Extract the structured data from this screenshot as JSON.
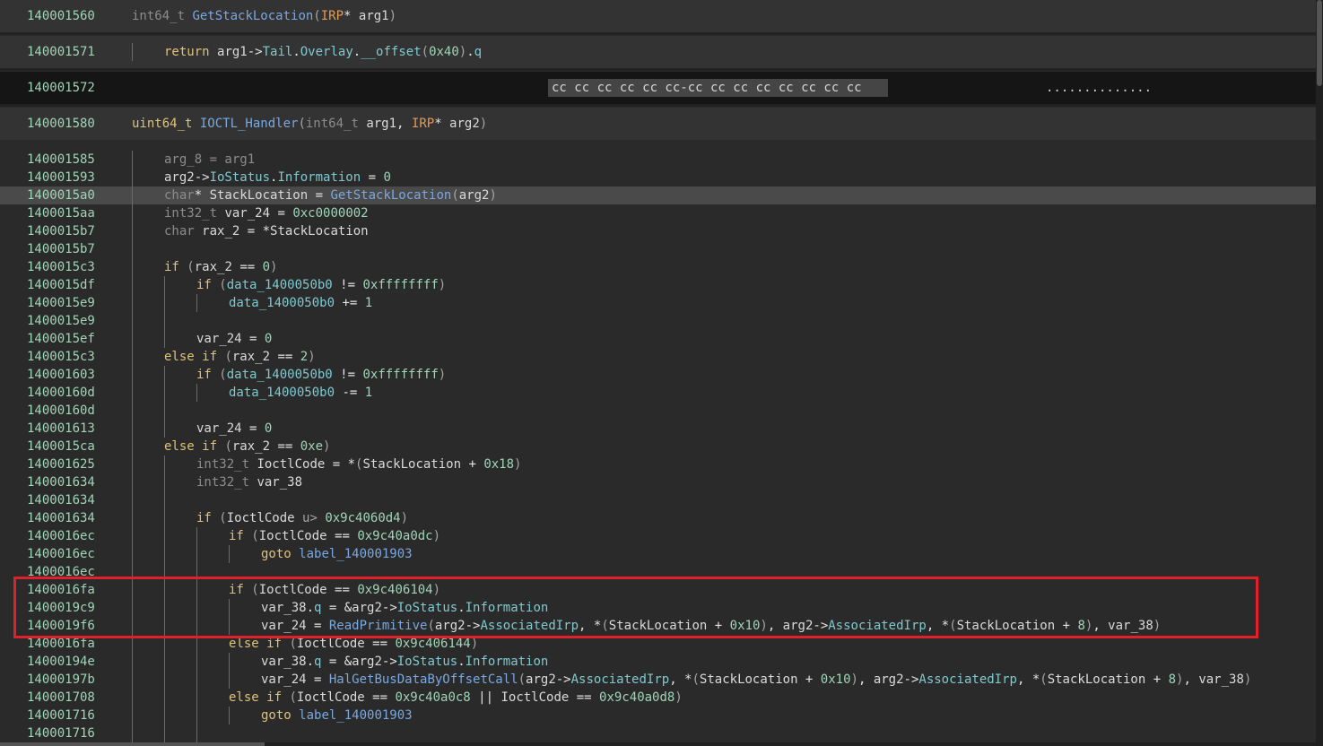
{
  "headers": [
    {
      "addr": "140001560",
      "dark": false,
      "tokens": [
        [
          "int64_t ",
          "ty"
        ],
        [
          "GetStackLocation",
          "fn"
        ],
        [
          "(",
          "gr"
        ],
        [
          "IRP",
          "irp"
        ],
        [
          "* ",
          "pl"
        ],
        [
          "arg1",
          "var"
        ],
        [
          ")",
          "gr"
        ]
      ]
    },
    {
      "addr": "140001571",
      "dark": false,
      "tokens": [
        [
          "return ",
          "kw"
        ],
        [
          "arg1",
          "var"
        ],
        [
          "->",
          "pl"
        ],
        [
          "Tail",
          "mem"
        ],
        [
          ".",
          "pl"
        ],
        [
          "Overlay",
          "mem"
        ],
        [
          ".",
          "pl"
        ],
        [
          "__offset",
          "mem"
        ],
        [
          "(",
          "gr"
        ],
        [
          "0x40",
          "num"
        ],
        [
          ")",
          "gr"
        ],
        [
          ".",
          "pl"
        ],
        [
          "q",
          "mem"
        ]
      ]
    },
    {
      "addr": "140001572",
      "dark": true,
      "hex": "cc cc cc cc cc cc-cc cc cc cc cc cc cc cc",
      "ascii": ".............."
    },
    {
      "addr": "140001580",
      "dark": false,
      "tokens": [
        [
          "uint64_t ",
          "kw"
        ],
        [
          "IOCTL_Handler",
          "fn"
        ],
        [
          "(",
          "gr"
        ],
        [
          "int64_t ",
          "ty"
        ],
        [
          "arg1",
          "var"
        ],
        [
          ", ",
          "pl"
        ],
        [
          "IRP",
          "irp"
        ],
        [
          "* ",
          "pl"
        ],
        [
          "arg2",
          "var"
        ],
        [
          ")",
          "gr"
        ]
      ]
    }
  ],
  "lines": [
    {
      "addr": "140001585",
      "indent": 1,
      "hl": false,
      "tokens": [
        [
          "arg_8 = arg1",
          "ty"
        ]
      ]
    },
    {
      "addr": "140001593",
      "indent": 1,
      "hl": false,
      "tokens": [
        [
          "arg2",
          "var"
        ],
        [
          "->",
          "pl"
        ],
        [
          "IoStatus",
          "mem"
        ],
        [
          ".",
          "pl"
        ],
        [
          "Information",
          "mem"
        ],
        [
          " = ",
          "pl"
        ],
        [
          "0",
          "num"
        ]
      ]
    },
    {
      "addr": "1400015a0",
      "indent": 1,
      "hl": true,
      "tokens": [
        [
          "char",
          "ty"
        ],
        [
          "* ",
          "pl"
        ],
        [
          "StackLocation",
          "var"
        ],
        [
          " = ",
          "pl"
        ],
        [
          "GetStackLocation",
          "fn"
        ],
        [
          "(",
          "gr"
        ],
        [
          "arg2",
          "var"
        ],
        [
          ")",
          "gr"
        ]
      ]
    },
    {
      "addr": "1400015aa",
      "indent": 1,
      "hl": false,
      "tokens": [
        [
          "int32_t ",
          "ty"
        ],
        [
          "var_24",
          "var"
        ],
        [
          " = ",
          "pl"
        ],
        [
          "0xc0000002",
          "num"
        ]
      ]
    },
    {
      "addr": "1400015b7",
      "indent": 1,
      "hl": false,
      "tokens": [
        [
          "char ",
          "ty"
        ],
        [
          "rax_2",
          "var"
        ],
        [
          " = *",
          "pl"
        ],
        [
          "StackLocation",
          "var"
        ]
      ]
    },
    {
      "addr": "1400015b7",
      "indent": 1,
      "hl": false,
      "tokens": []
    },
    {
      "addr": "1400015c3",
      "indent": 1,
      "hl": false,
      "tokens": [
        [
          "if ",
          "kw"
        ],
        [
          "(",
          "gr"
        ],
        [
          "rax_2",
          "var"
        ],
        [
          " == ",
          "pl"
        ],
        [
          "0",
          "num"
        ],
        [
          ")",
          "gr"
        ]
      ]
    },
    {
      "addr": "1400015df",
      "indent": 2,
      "hl": false,
      "tokens": [
        [
          "if ",
          "kw"
        ],
        [
          "(",
          "gr"
        ],
        [
          "data_1400050b0",
          "mem"
        ],
        [
          " != ",
          "pl"
        ],
        [
          "0xffffffff",
          "num"
        ],
        [
          ")",
          "gr"
        ]
      ]
    },
    {
      "addr": "1400015e9",
      "indent": 3,
      "hl": false,
      "tokens": [
        [
          "data_1400050b0",
          "mem"
        ],
        [
          " += ",
          "pl"
        ],
        [
          "1",
          "num"
        ]
      ]
    },
    {
      "addr": "1400015e9",
      "indent": 2,
      "hl": false,
      "tokens": []
    },
    {
      "addr": "1400015ef",
      "indent": 2,
      "hl": false,
      "tokens": [
        [
          "var_24",
          "var"
        ],
        [
          " = ",
          "pl"
        ],
        [
          "0",
          "num"
        ]
      ]
    },
    {
      "addr": "1400015c3",
      "indent": 1,
      "hl": false,
      "tokens": [
        [
          "else if ",
          "kw"
        ],
        [
          "(",
          "gr"
        ],
        [
          "rax_2",
          "var"
        ],
        [
          " == ",
          "pl"
        ],
        [
          "2",
          "num"
        ],
        [
          ")",
          "gr"
        ]
      ]
    },
    {
      "addr": "140001603",
      "indent": 2,
      "hl": false,
      "tokens": [
        [
          "if ",
          "kw"
        ],
        [
          "(",
          "gr"
        ],
        [
          "data_1400050b0",
          "mem"
        ],
        [
          " != ",
          "pl"
        ],
        [
          "0xffffffff",
          "num"
        ],
        [
          ")",
          "gr"
        ]
      ]
    },
    {
      "addr": "14000160d",
      "indent": 3,
      "hl": false,
      "tokens": [
        [
          "data_1400050b0",
          "mem"
        ],
        [
          " -= ",
          "pl"
        ],
        [
          "1",
          "num"
        ]
      ]
    },
    {
      "addr": "14000160d",
      "indent": 2,
      "hl": false,
      "tokens": []
    },
    {
      "addr": "140001613",
      "indent": 2,
      "hl": false,
      "tokens": [
        [
          "var_24",
          "var"
        ],
        [
          " = ",
          "pl"
        ],
        [
          "0",
          "num"
        ]
      ]
    },
    {
      "addr": "1400015ca",
      "indent": 1,
      "hl": false,
      "tokens": [
        [
          "else if ",
          "kw"
        ],
        [
          "(",
          "gr"
        ],
        [
          "rax_2",
          "var"
        ],
        [
          " == ",
          "pl"
        ],
        [
          "0xe",
          "num"
        ],
        [
          ")",
          "gr"
        ]
      ]
    },
    {
      "addr": "140001625",
      "indent": 2,
      "hl": false,
      "tokens": [
        [
          "int32_t ",
          "ty"
        ],
        [
          "IoctlCode",
          "var"
        ],
        [
          " = *",
          "pl"
        ],
        [
          "(",
          "gr"
        ],
        [
          "StackLocation",
          "var"
        ],
        [
          " + ",
          "pl"
        ],
        [
          "0x18",
          "num"
        ],
        [
          ")",
          "gr"
        ]
      ]
    },
    {
      "addr": "140001634",
      "indent": 2,
      "hl": false,
      "tokens": [
        [
          "int32_t ",
          "ty"
        ],
        [
          "var_38",
          "var"
        ]
      ]
    },
    {
      "addr": "140001634",
      "indent": 2,
      "hl": false,
      "tokens": []
    },
    {
      "addr": "140001634",
      "indent": 2,
      "hl": false,
      "tokens": [
        [
          "if ",
          "kw"
        ],
        [
          "(",
          "gr"
        ],
        [
          "IoctlCode",
          "var"
        ],
        [
          " u> ",
          "gr"
        ],
        [
          "0x9c4060d4",
          "num"
        ],
        [
          ")",
          "gr"
        ]
      ]
    },
    {
      "addr": "1400016ec",
      "indent": 3,
      "hl": false,
      "tokens": [
        [
          "if ",
          "kw"
        ],
        [
          "(",
          "gr"
        ],
        [
          "IoctlCode",
          "var"
        ],
        [
          " == ",
          "pl"
        ],
        [
          "0x9c40a0dc",
          "num"
        ],
        [
          ")",
          "gr"
        ]
      ]
    },
    {
      "addr": "1400016ec",
      "indent": 4,
      "hl": false,
      "tokens": [
        [
          "goto ",
          "kw"
        ],
        [
          "label_140001903",
          "lbl"
        ]
      ]
    },
    {
      "addr": "1400016ec",
      "indent": 3,
      "hl": false,
      "tokens": []
    },
    {
      "addr": "1400016fa",
      "indent": 3,
      "hl": false,
      "tokens": [
        [
          "if ",
          "kw"
        ],
        [
          "(",
          "gr"
        ],
        [
          "IoctlCode",
          "var"
        ],
        [
          " == ",
          "pl"
        ],
        [
          "0x9c406104",
          "num"
        ],
        [
          ")",
          "gr"
        ]
      ]
    },
    {
      "addr": "1400019c9",
      "indent": 4,
      "hl": false,
      "tokens": [
        [
          "var_38",
          "var"
        ],
        [
          ".",
          "pl"
        ],
        [
          "q",
          "mem"
        ],
        [
          " = &",
          "pl"
        ],
        [
          "arg2",
          "var"
        ],
        [
          "->",
          "pl"
        ],
        [
          "IoStatus",
          "mem"
        ],
        [
          ".",
          "pl"
        ],
        [
          "Information",
          "mem"
        ]
      ]
    },
    {
      "addr": "1400019f6",
      "indent": 4,
      "hl": false,
      "tokens": [
        [
          "var_24",
          "var"
        ],
        [
          " = ",
          "pl"
        ],
        [
          "ReadPrimitive",
          "fn"
        ],
        [
          "(",
          "gr"
        ],
        [
          "arg2",
          "var"
        ],
        [
          "->",
          "pl"
        ],
        [
          "AssociatedIrp",
          "mem"
        ],
        [
          ", *",
          "pl"
        ],
        [
          "(",
          "gr"
        ],
        [
          "StackLocation",
          "var"
        ],
        [
          " + ",
          "pl"
        ],
        [
          "0x10",
          "num"
        ],
        [
          ")",
          "gr"
        ],
        [
          ", ",
          "pl"
        ],
        [
          "arg2",
          "var"
        ],
        [
          "->",
          "pl"
        ],
        [
          "AssociatedIrp",
          "mem"
        ],
        [
          ", *",
          "pl"
        ],
        [
          "(",
          "gr"
        ],
        [
          "StackLocation",
          "var"
        ],
        [
          " + ",
          "pl"
        ],
        [
          "8",
          "num"
        ],
        [
          ")",
          "gr"
        ],
        [
          ", ",
          "pl"
        ],
        [
          "var_38",
          "var"
        ],
        [
          ")",
          "gr"
        ]
      ]
    },
    {
      "addr": "1400016fa",
      "indent": 3,
      "hl": false,
      "tokens": [
        [
          "else if ",
          "kw"
        ],
        [
          "(",
          "gr"
        ],
        [
          "IoctlCode",
          "var"
        ],
        [
          " == ",
          "pl"
        ],
        [
          "0x9c406144",
          "num"
        ],
        [
          ")",
          "gr"
        ]
      ]
    },
    {
      "addr": "14000194e",
      "indent": 4,
      "hl": false,
      "tokens": [
        [
          "var_38",
          "var"
        ],
        [
          ".",
          "pl"
        ],
        [
          "q",
          "mem"
        ],
        [
          " = &",
          "pl"
        ],
        [
          "arg2",
          "var"
        ],
        [
          "->",
          "pl"
        ],
        [
          "IoStatus",
          "mem"
        ],
        [
          ".",
          "pl"
        ],
        [
          "Information",
          "mem"
        ]
      ]
    },
    {
      "addr": "14000197b",
      "indent": 4,
      "hl": false,
      "tokens": [
        [
          "var_24",
          "var"
        ],
        [
          " = ",
          "pl"
        ],
        [
          "HalGetBusDataByOffsetCall",
          "fn"
        ],
        [
          "(",
          "gr"
        ],
        [
          "arg2",
          "var"
        ],
        [
          "->",
          "pl"
        ],
        [
          "AssociatedIrp",
          "mem"
        ],
        [
          ", *",
          "pl"
        ],
        [
          "(",
          "gr"
        ],
        [
          "StackLocation",
          "var"
        ],
        [
          " + ",
          "pl"
        ],
        [
          "0x10",
          "num"
        ],
        [
          ")",
          "gr"
        ],
        [
          ", ",
          "pl"
        ],
        [
          "arg2",
          "var"
        ],
        [
          "->",
          "pl"
        ],
        [
          "AssociatedIrp",
          "mem"
        ],
        [
          ", *",
          "pl"
        ],
        [
          "(",
          "gr"
        ],
        [
          "StackLocation",
          "var"
        ],
        [
          " + ",
          "pl"
        ],
        [
          "8",
          "num"
        ],
        [
          ")",
          "gr"
        ],
        [
          ", ",
          "pl"
        ],
        [
          "var_38",
          "var"
        ],
        [
          ")",
          "gr"
        ]
      ]
    },
    {
      "addr": "140001708",
      "indent": 3,
      "hl": false,
      "tokens": [
        [
          "else if ",
          "kw"
        ],
        [
          "(",
          "gr"
        ],
        [
          "IoctlCode",
          "var"
        ],
        [
          " == ",
          "pl"
        ],
        [
          "0x9c40a0c8",
          "num"
        ],
        [
          " || ",
          "pl"
        ],
        [
          "IoctlCode",
          "var"
        ],
        [
          " == ",
          "pl"
        ],
        [
          "0x9c40a0d8",
          "num"
        ],
        [
          ")",
          "gr"
        ]
      ]
    },
    {
      "addr": "140001716",
      "indent": 4,
      "hl": false,
      "tokens": [
        [
          "goto ",
          "kw"
        ],
        [
          "label_140001903",
          "lbl"
        ]
      ]
    },
    {
      "addr": "140001716",
      "indent": 3,
      "hl": false,
      "tokens": []
    }
  ],
  "annotation": {
    "color": "#e0202a"
  }
}
